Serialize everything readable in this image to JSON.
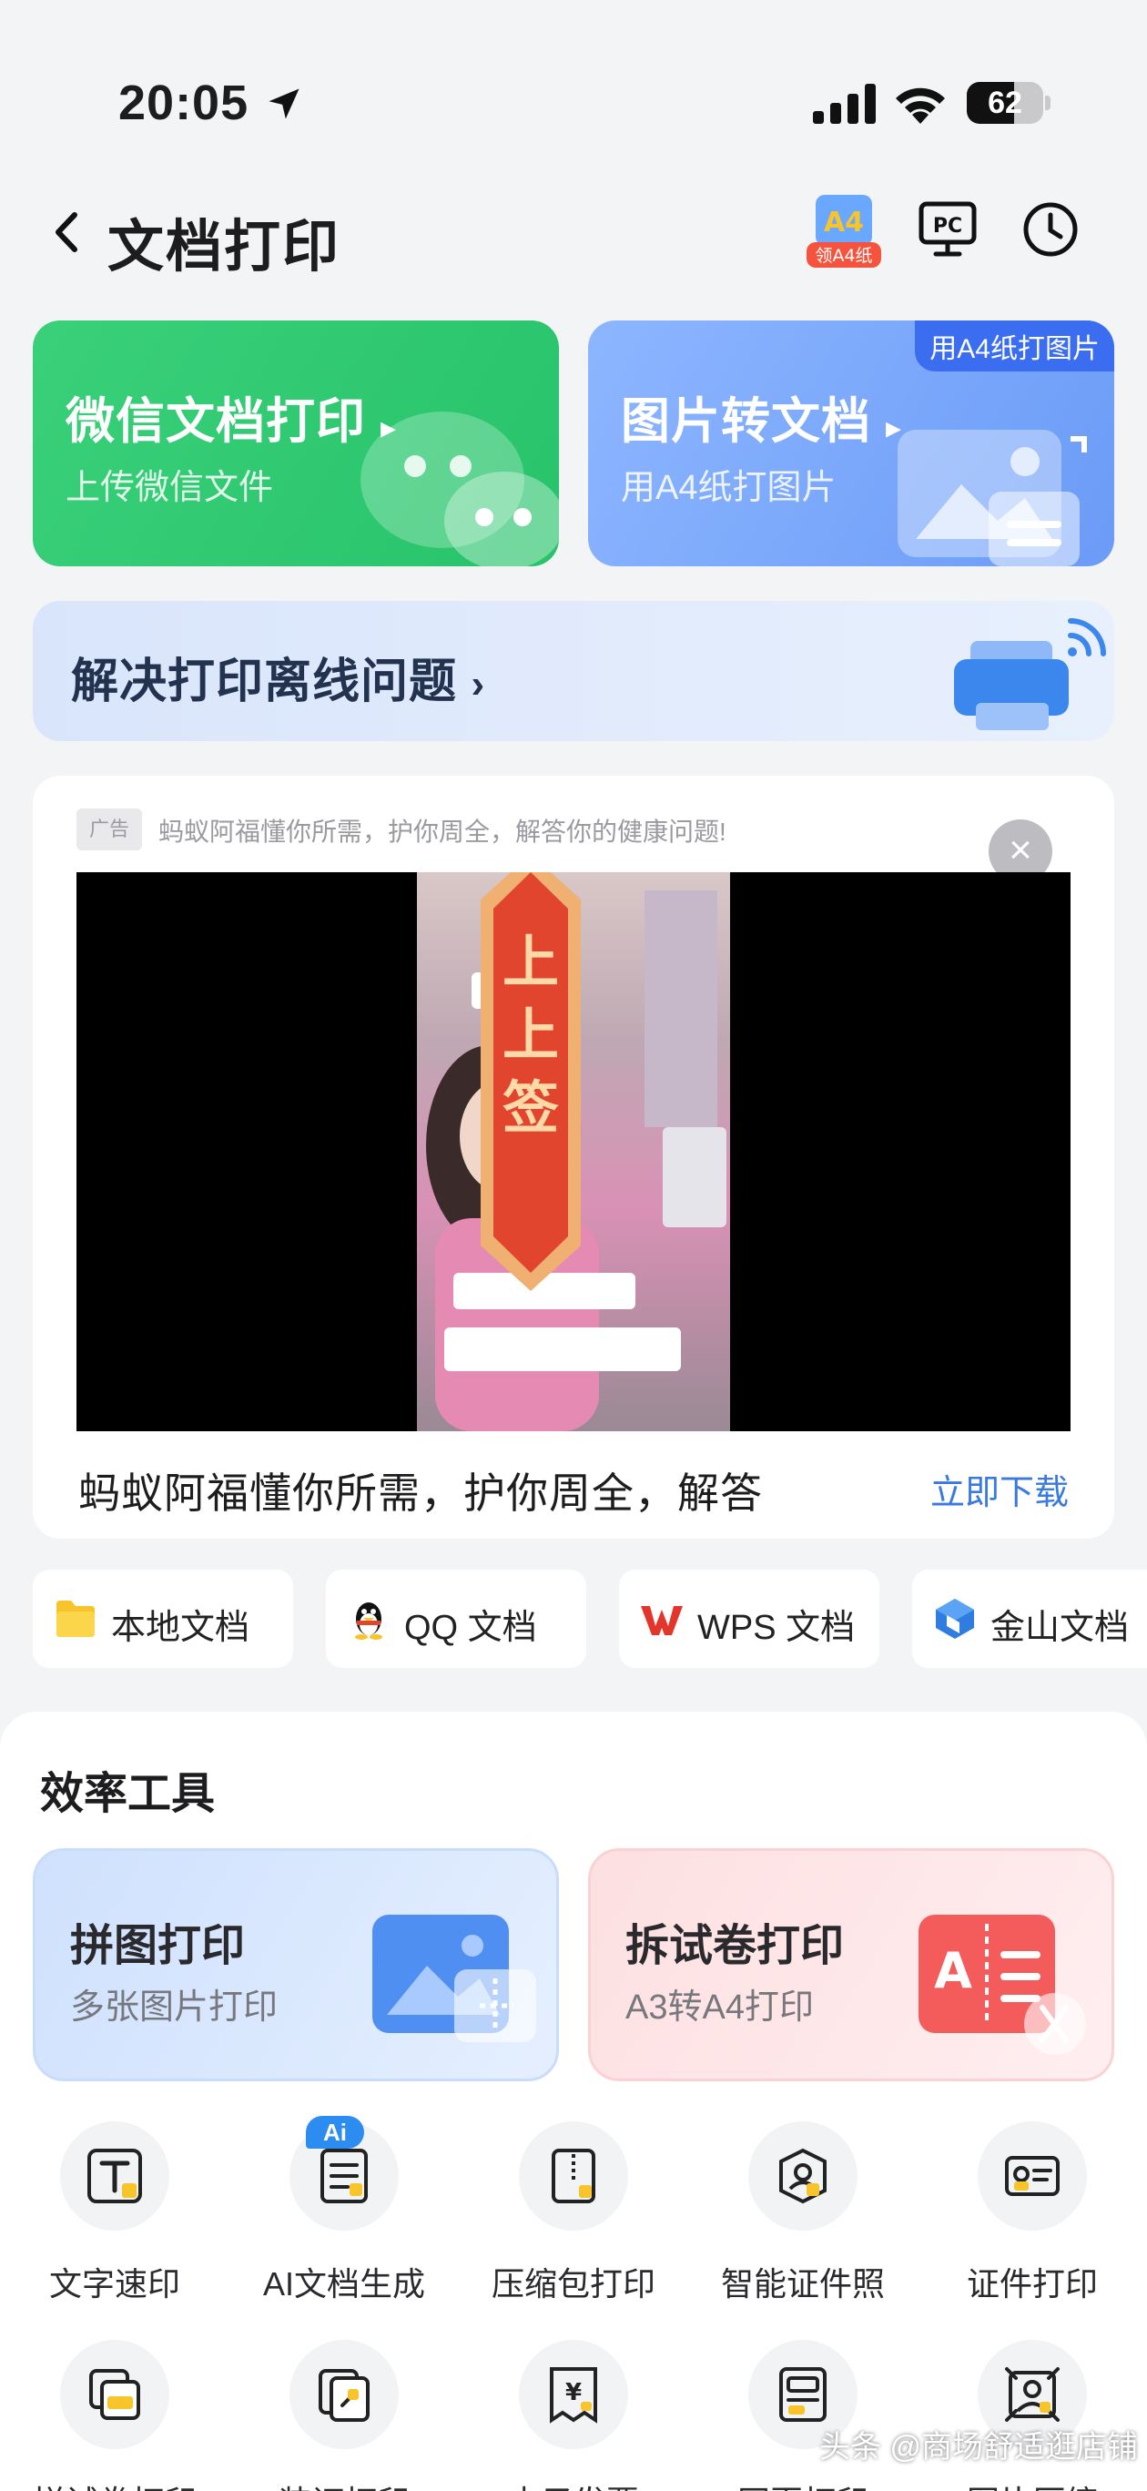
{
  "status_bar": {
    "time": "20:05",
    "battery": "62",
    "battery_level": 0.62
  },
  "header": {
    "title": "文档打印",
    "a4_badge_label": "领A4纸"
  },
  "top_cards": [
    {
      "title": "微信文档打印",
      "subtitle": "上传微信文件",
      "badge": ""
    },
    {
      "title": "图片转文档",
      "subtitle": "用A4纸打图片",
      "badge": "用A4纸打图片"
    }
  ],
  "offline": {
    "label": "解决打印离线问题"
  },
  "ad": {
    "label": "广告",
    "description": "蚂蚁阿福懂你所需，护你周全，解答你的健康问题!",
    "title": "蚂蚁阿福懂你所需，护你周全，解答",
    "cta": "立即下载",
    "overlay_text": "上上签"
  },
  "sources": [
    {
      "label": "本地文档",
      "icon": "folder-icon"
    },
    {
      "label": "QQ 文档",
      "icon": "qq-penguin-icon"
    },
    {
      "label": "WPS 文档",
      "icon": "wps-icon"
    },
    {
      "label": "金山文档",
      "icon": "kingsoft-docs-icon"
    }
  ],
  "tools": {
    "section_title": "效率工具",
    "featured": [
      {
        "title": "拼图打印",
        "subtitle": "多张图片打印"
      },
      {
        "title": "拆试卷打印",
        "subtitle": "A3转A4打印"
      }
    ],
    "grid": [
      {
        "label": "文字速印",
        "icon": "text-t-icon"
      },
      {
        "label": "AI文档生成",
        "icon": "ai-document-icon",
        "badge": "Ai"
      },
      {
        "label": "压缩包打印",
        "icon": "zip-file-icon"
      },
      {
        "label": "智能证件照",
        "icon": "id-photo-icon"
      },
      {
        "label": "证件打印",
        "icon": "id-card-icon"
      },
      {
        "label": "拼试卷打印",
        "icon": "exam-stack-icon"
      },
      {
        "label": "装订打印",
        "icon": "binding-icon"
      },
      {
        "label": "电子发票",
        "icon": "invoice-yen-icon"
      },
      {
        "label": "网页打印",
        "icon": "webpage-icon"
      },
      {
        "label": "图片压缩",
        "icon": "image-compress-icon"
      }
    ]
  },
  "watermark": "头条 @商场舒适逛店铺",
  "colors": {
    "wechat_green": "#2ec971",
    "image_blue": "#7ea9fb",
    "link_blue": "#3a7ae0",
    "accent_yellow": "#f7c52b"
  }
}
